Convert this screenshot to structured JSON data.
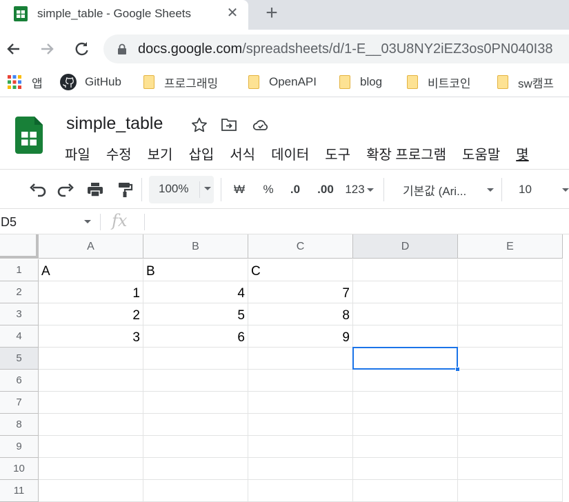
{
  "browser": {
    "tab_title": "simple_table - Google Sheets",
    "tab_close": "✕",
    "new_tab": "+",
    "url_host": "docs.google.com",
    "url_path": "/spreadsheets/d/1-E__03U8NY2iEZ3os0PN040I38"
  },
  "bookmarks": [
    {
      "label": "앱",
      "icon": "apps-grid-icon"
    },
    {
      "label": "GitHub",
      "icon": "github-icon"
    },
    {
      "label": "프로그래밍",
      "icon": "folder-icon"
    },
    {
      "label": "OpenAPI",
      "icon": "folder-icon"
    },
    {
      "label": "blog",
      "icon": "folder-icon"
    },
    {
      "label": "비트코인",
      "icon": "folder-icon"
    },
    {
      "label": "sw캠프",
      "icon": "folder-icon"
    }
  ],
  "doc": {
    "title": "simple_table"
  },
  "menu": [
    "파일",
    "수정",
    "보기",
    "삽입",
    "서식",
    "데이터",
    "도구",
    "확장 프로그램",
    "도움말",
    "몇"
  ],
  "toolbar": {
    "zoom": "100%",
    "currency": "₩",
    "percent": "%",
    "decrease_decimal": ".0",
    "increase_decimal": ".00",
    "number_format": "123",
    "font": "기본값 (Ari...",
    "font_size": "10"
  },
  "formula_bar": {
    "name_box": "D5",
    "fx": "fx",
    "value": ""
  },
  "grid": {
    "columns": [
      "A",
      "B",
      "C",
      "D",
      "E"
    ],
    "rows": [
      "1",
      "2",
      "3",
      "4",
      "5",
      "6",
      "7",
      "8",
      "9",
      "10",
      "11"
    ],
    "selected_cell": "D5",
    "cells": [
      [
        "A",
        "B",
        "C",
        "",
        ""
      ],
      [
        "1",
        "4",
        "7",
        "",
        ""
      ],
      [
        "2",
        "5",
        "8",
        "",
        ""
      ],
      [
        "3",
        "6",
        "9",
        "",
        ""
      ],
      [
        "",
        "",
        "",
        "",
        ""
      ],
      [
        "",
        "",
        "",
        "",
        ""
      ],
      [
        "",
        "",
        "",
        "",
        ""
      ],
      [
        "",
        "",
        "",
        "",
        ""
      ],
      [
        "",
        "",
        "",
        "",
        ""
      ],
      [
        "",
        "",
        "",
        "",
        ""
      ],
      [
        "",
        "",
        "",
        "",
        ""
      ]
    ]
  },
  "colors": {
    "sheets_green": "#188038",
    "selection_blue": "#1a73e8"
  }
}
